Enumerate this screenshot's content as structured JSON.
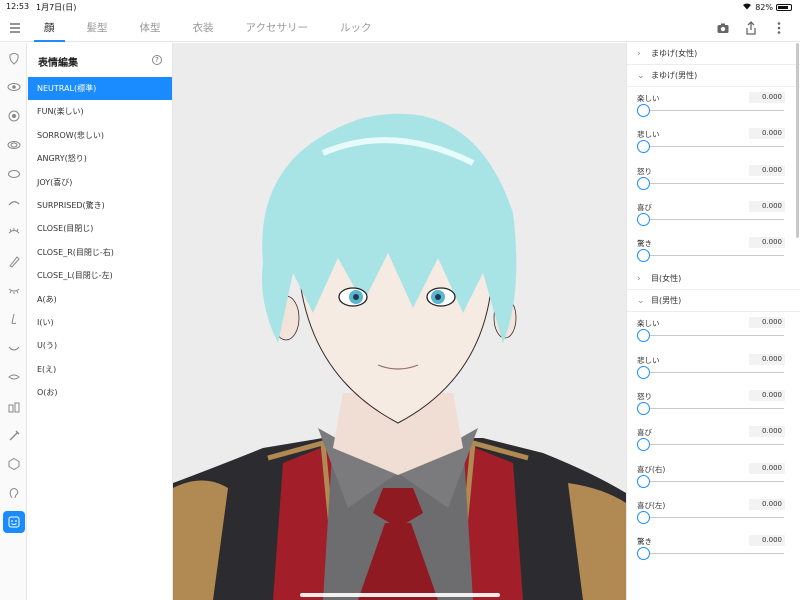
{
  "status": {
    "time": "12:53",
    "date": "1月7日(日)",
    "battery": "82%",
    "battery_level": 0.82
  },
  "tabs": [
    "顔",
    "髪型",
    "体型",
    "衣装",
    "アクセサリー",
    "ルック"
  ],
  "rail_icons": [
    "face-outline-icon",
    "eye-icon",
    "iris-icon",
    "eye-shape-icon",
    "oval-icon",
    "eyebrow-icon",
    "eyelash-icon",
    "brush-icon",
    "eye-closed-icon",
    "nose-icon",
    "mouth-icon",
    "lip-icon",
    "bottles-icon",
    "pipette-icon",
    "hexagon-icon",
    "ear-icon",
    "expression-icon"
  ],
  "expressions": {
    "title": "表情編集",
    "items": [
      "NEUTRAL(標準)",
      "FUN(楽しい)",
      "SORROW(悲しい)",
      "ANGRY(怒り)",
      "JOY(喜び)",
      "SURPRISED(驚き)",
      "CLOSE(目閉じ)",
      "CLOSE_R(目閉じ-右)",
      "CLOSE_L(目閉じ-左)",
      "A(あ)",
      "I(い)",
      "U(う)",
      "E(え)",
      "O(お)"
    ]
  },
  "sliders": {
    "sections": [
      {
        "label": "まゆげ(女性)",
        "expanded": false,
        "rows": []
      },
      {
        "label": "まゆげ(男性)",
        "expanded": true,
        "rows": [
          {
            "name": "楽しい",
            "value": "0.000"
          },
          {
            "name": "悲しい",
            "value": "0.000"
          },
          {
            "name": "怒り",
            "value": "0.000"
          },
          {
            "name": "喜び",
            "value": "0.000"
          },
          {
            "name": "驚き",
            "value": "0.000"
          }
        ]
      },
      {
        "label": "目(女性)",
        "expanded": false,
        "rows": []
      },
      {
        "label": "目(男性)",
        "expanded": true,
        "rows": [
          {
            "name": "楽しい",
            "value": "0.000"
          },
          {
            "name": "悲しい",
            "value": "0.000"
          },
          {
            "name": "怒り",
            "value": "0.000"
          },
          {
            "name": "喜び",
            "value": "0.000"
          },
          {
            "name": "喜び(右)",
            "value": "0.000"
          },
          {
            "name": "喜び(左)",
            "value": "0.000"
          },
          {
            "name": "驚き",
            "value": "0.000"
          }
        ]
      }
    ]
  },
  "colors": {
    "accent": "#1a8cff",
    "hair": "#a8e4e6",
    "skin": "#f6ebe3",
    "jacket": "#2c2c30",
    "vest": "#a21e28",
    "gold": "#b08a52"
  }
}
